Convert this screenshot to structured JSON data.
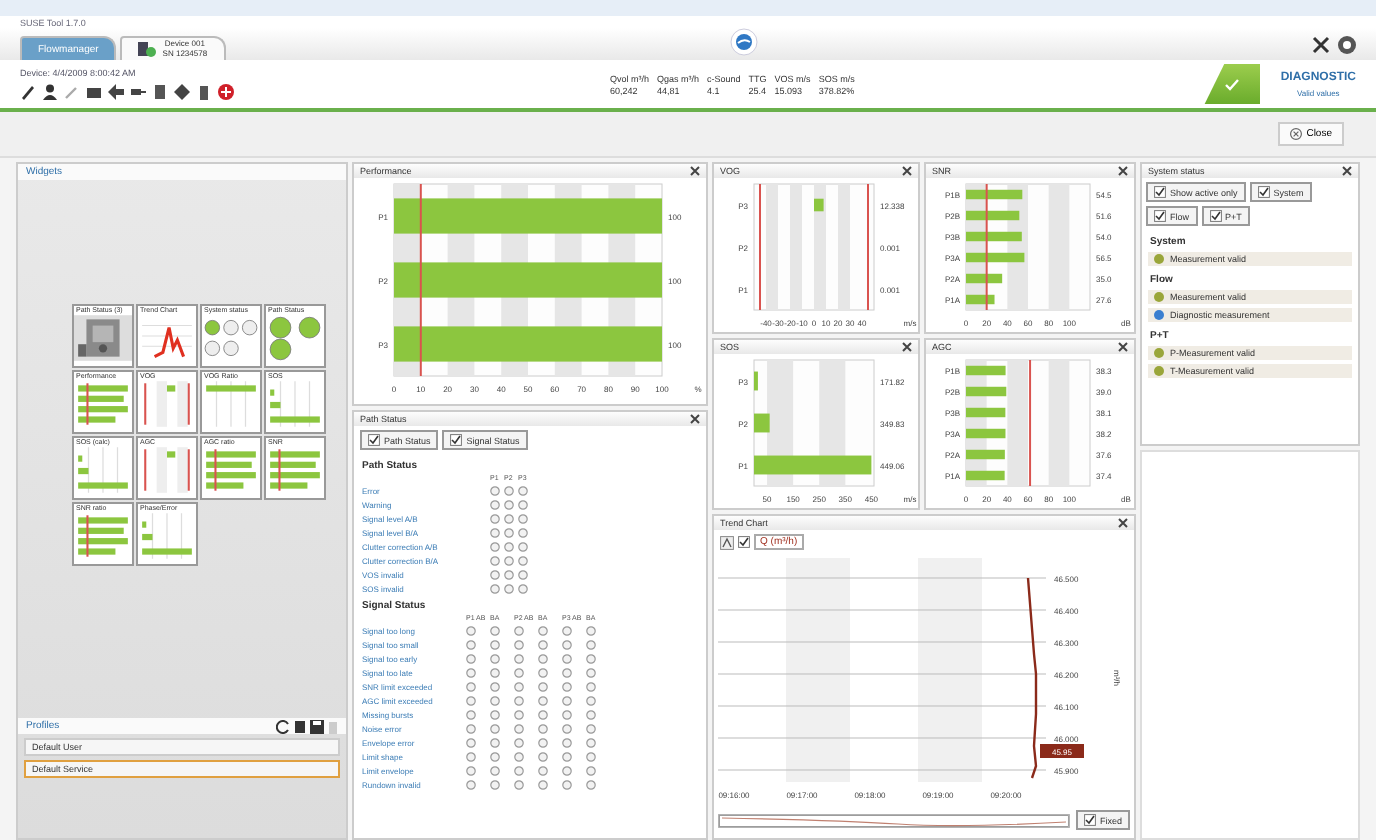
{
  "window": {
    "title": "SUSE Tool 1.7.0"
  },
  "tabs": [
    {
      "label": "Flowmanager",
      "selected": false
    },
    {
      "label": "Device 001",
      "sublabel": "SN 1234578",
      "selected": true
    }
  ],
  "device": {
    "info": "Device: 4/4/2009 8:00:42 AM"
  },
  "readings": [
    {
      "label": "Qvol m³/h",
      "value": "60,242"
    },
    {
      "label": "Qgas m³/h",
      "value": "44,81"
    },
    {
      "label": "c-Sound",
      "value": "4.1"
    },
    {
      "label": "TTG",
      "value": "25.4"
    },
    {
      "label": "VOS m/s",
      "value": "15.093"
    },
    {
      "label": "SOS m/s",
      "value": "378.82%"
    }
  ],
  "status": {
    "ok": true,
    "label": "DIAGNOSTIC",
    "sublabel": "Valid values"
  },
  "close_button": "Close",
  "widgets": {
    "title": "Widgets",
    "items": [
      {
        "label": "Path Status (3)"
      },
      {
        "label": "Trend Chart",
        "kind": "trend"
      },
      {
        "label": "System status",
        "kind": "dots"
      },
      {
        "label": "Path Status",
        "kind": "bigdots"
      },
      {
        "label": "Performance",
        "kind": "hbars"
      },
      {
        "label": "VOG",
        "kind": "vlines"
      },
      {
        "label": "VOG Ratio",
        "kind": "topbar"
      },
      {
        "label": "SOS",
        "kind": "steps"
      },
      {
        "label": "SOS (calc)",
        "kind": "steps"
      },
      {
        "label": "AGC",
        "kind": "vlines"
      },
      {
        "label": "AGC ratio",
        "kind": "hbars"
      },
      {
        "label": "SNR",
        "kind": "hbars"
      },
      {
        "label": "SNR ratio",
        "kind": "hbars"
      },
      {
        "label": "Phase/Error",
        "kind": "steps"
      }
    ]
  },
  "profiles": {
    "title": "Profiles",
    "items": [
      {
        "label": "Default User",
        "selected": false
      },
      {
        "label": "Default Service",
        "selected": true
      }
    ]
  },
  "performance": {
    "title": "Performance",
    "chart_data": {
      "type": "bar",
      "orientation": "horizontal",
      "categories": [
        "P1",
        "P2",
        "P3"
      ],
      "values": [
        100,
        100,
        100
      ],
      "xlim": [
        0,
        100
      ],
      "xticks": [
        0,
        10,
        20,
        30,
        40,
        50,
        60,
        70,
        80,
        90,
        100
      ],
      "xlabel": "%",
      "value_labels": [
        "100",
        "100",
        "100"
      ],
      "ref_lines": [
        {
          "axis": "x",
          "value": 10,
          "color": "#d9534f"
        }
      ]
    }
  },
  "path_status": {
    "title": "Path Status",
    "toggles": [
      {
        "label": "Path Status",
        "checked": true
      },
      {
        "label": "Signal Status",
        "checked": true
      }
    ],
    "path_heading": "Path Status",
    "path_columns": [
      "P1",
      "P2",
      "P3"
    ],
    "path_rows": [
      "Error",
      "Warning",
      "Signal level A/B",
      "Signal level B/A",
      "Clutter correction A/B",
      "Clutter correction B/A",
      "VOS invalid",
      "SOS invalid"
    ],
    "signal_heading": "Signal Status",
    "signal_columns": [
      "P1 AB",
      "BA",
      "P2 AB",
      "BA",
      "P3 AB",
      "BA"
    ],
    "signal_rows": [
      "Signal too long",
      "Signal too small",
      "Signal too early",
      "Signal too late",
      "SNR limit exceeded",
      "AGC limit exceeded",
      "Missing bursts",
      "Noise error",
      "Envelope error",
      "Limit shape",
      "Limit envelope",
      "Rundown invalid"
    ]
  },
  "vog": {
    "title": "VOG",
    "readings": [
      "12.338",
      "0.001",
      "0.001"
    ],
    "chart_data": {
      "type": "bar",
      "orientation": "horizontal",
      "categories": [
        "P3",
        "P2",
        "P1"
      ],
      "values": [
        8,
        null,
        null
      ],
      "xlim": [
        -50,
        50
      ],
      "xticks": [
        -40,
        -30,
        -20,
        -10,
        0,
        10,
        20,
        30,
        40
      ],
      "xlabel": "m/s",
      "ref_lines": [
        {
          "axis": "x",
          "value": -45,
          "color": "#d9534f"
        },
        {
          "axis": "x",
          "value": 45,
          "color": "#d9534f"
        }
      ]
    }
  },
  "snr": {
    "title": "SNR",
    "chart_data": {
      "type": "bar",
      "orientation": "horizontal",
      "categories": [
        "P1B",
        "P2B",
        "P3B",
        "P3A",
        "P2A",
        "P1A"
      ],
      "values": [
        54.5,
        51.6,
        54,
        56.5,
        35,
        27.6
      ],
      "xlim": [
        0,
        120
      ],
      "xticks": [
        0,
        20,
        40,
        60,
        80,
        100
      ],
      "xlabel": "dB",
      "value_labels": [
        "54.5",
        "51.6",
        "54.0",
        "56.5",
        "35.0",
        "27.6"
      ],
      "ref_lines": [
        {
          "axis": "x",
          "value": 20,
          "color": "#d9534f"
        }
      ]
    }
  },
  "sos": {
    "title": "SOS",
    "readings": [
      "171.82",
      "349.83",
      "449.06"
    ],
    "chart_data": {
      "type": "bar",
      "orientation": "horizontal",
      "categories": [
        "P3",
        "P2",
        "P1"
      ],
      "values": [
        15,
        60,
        450
      ],
      "xlim": [
        0,
        460
      ],
      "xticks": [
        50,
        150,
        250,
        350,
        450
      ],
      "xlabel": "m/s"
    }
  },
  "agc": {
    "title": "AGC",
    "chart_data": {
      "type": "bar",
      "orientation": "horizontal",
      "categories": [
        "P1B",
        "P2B",
        "P3B",
        "P3A",
        "P2A",
        "P1A"
      ],
      "values": [
        38.3,
        39,
        38.1,
        38.2,
        37.6,
        37.4
      ],
      "xlim": [
        0,
        120
      ],
      "xticks": [
        0,
        20,
        40,
        60,
        80,
        100
      ],
      "xlabel": "dB",
      "value_labels": [
        "38.3",
        "39.0",
        "38.1",
        "38.2",
        "37.6",
        "37.4"
      ],
      "ref_lines": [
        {
          "axis": "x",
          "value": 62,
          "color": "#d9534f"
        }
      ]
    }
  },
  "trend": {
    "title": "Trend Chart",
    "legend": {
      "label": "Q (m³/h)",
      "checked": true
    },
    "y_tick_labels": [
      "46.500",
      "46.400",
      "46.300",
      "46.200",
      "46.100",
      "46.000",
      "45.900"
    ],
    "y_axis_label": "m³/h",
    "x_tick_labels": [
      "09:16:00",
      "09:17:00",
      "09:18:00",
      "09:19:00",
      "09:20:00"
    ],
    "current_value": "45.95",
    "range": {
      "level": 1
    },
    "fixed": {
      "label": "Fixed",
      "checked": true
    }
  },
  "system_status": {
    "title": "System status",
    "filters": [
      {
        "label": "Show active only",
        "checked": true
      },
      {
        "label": "System",
        "checked": true
      },
      {
        "label": "Flow",
        "checked": true
      },
      {
        "label": "P+T",
        "checked": true
      }
    ],
    "groups": [
      {
        "title": "System",
        "entries": [
          {
            "label": "Measurement valid",
            "color": "#9aa63a"
          }
        ]
      },
      {
        "title": "Flow",
        "entries": [
          {
            "label": "Measurement valid",
            "color": "#9aa63a"
          },
          {
            "label": "Diagnostic measurement",
            "color": "#3a7fd0"
          }
        ]
      },
      {
        "title": "P+T",
        "entries": [
          {
            "label": "P-Measurement valid",
            "color": "#9aa63a"
          },
          {
            "label": "T-Measurement valid",
            "color": "#9aa63a"
          }
        ]
      }
    ]
  }
}
